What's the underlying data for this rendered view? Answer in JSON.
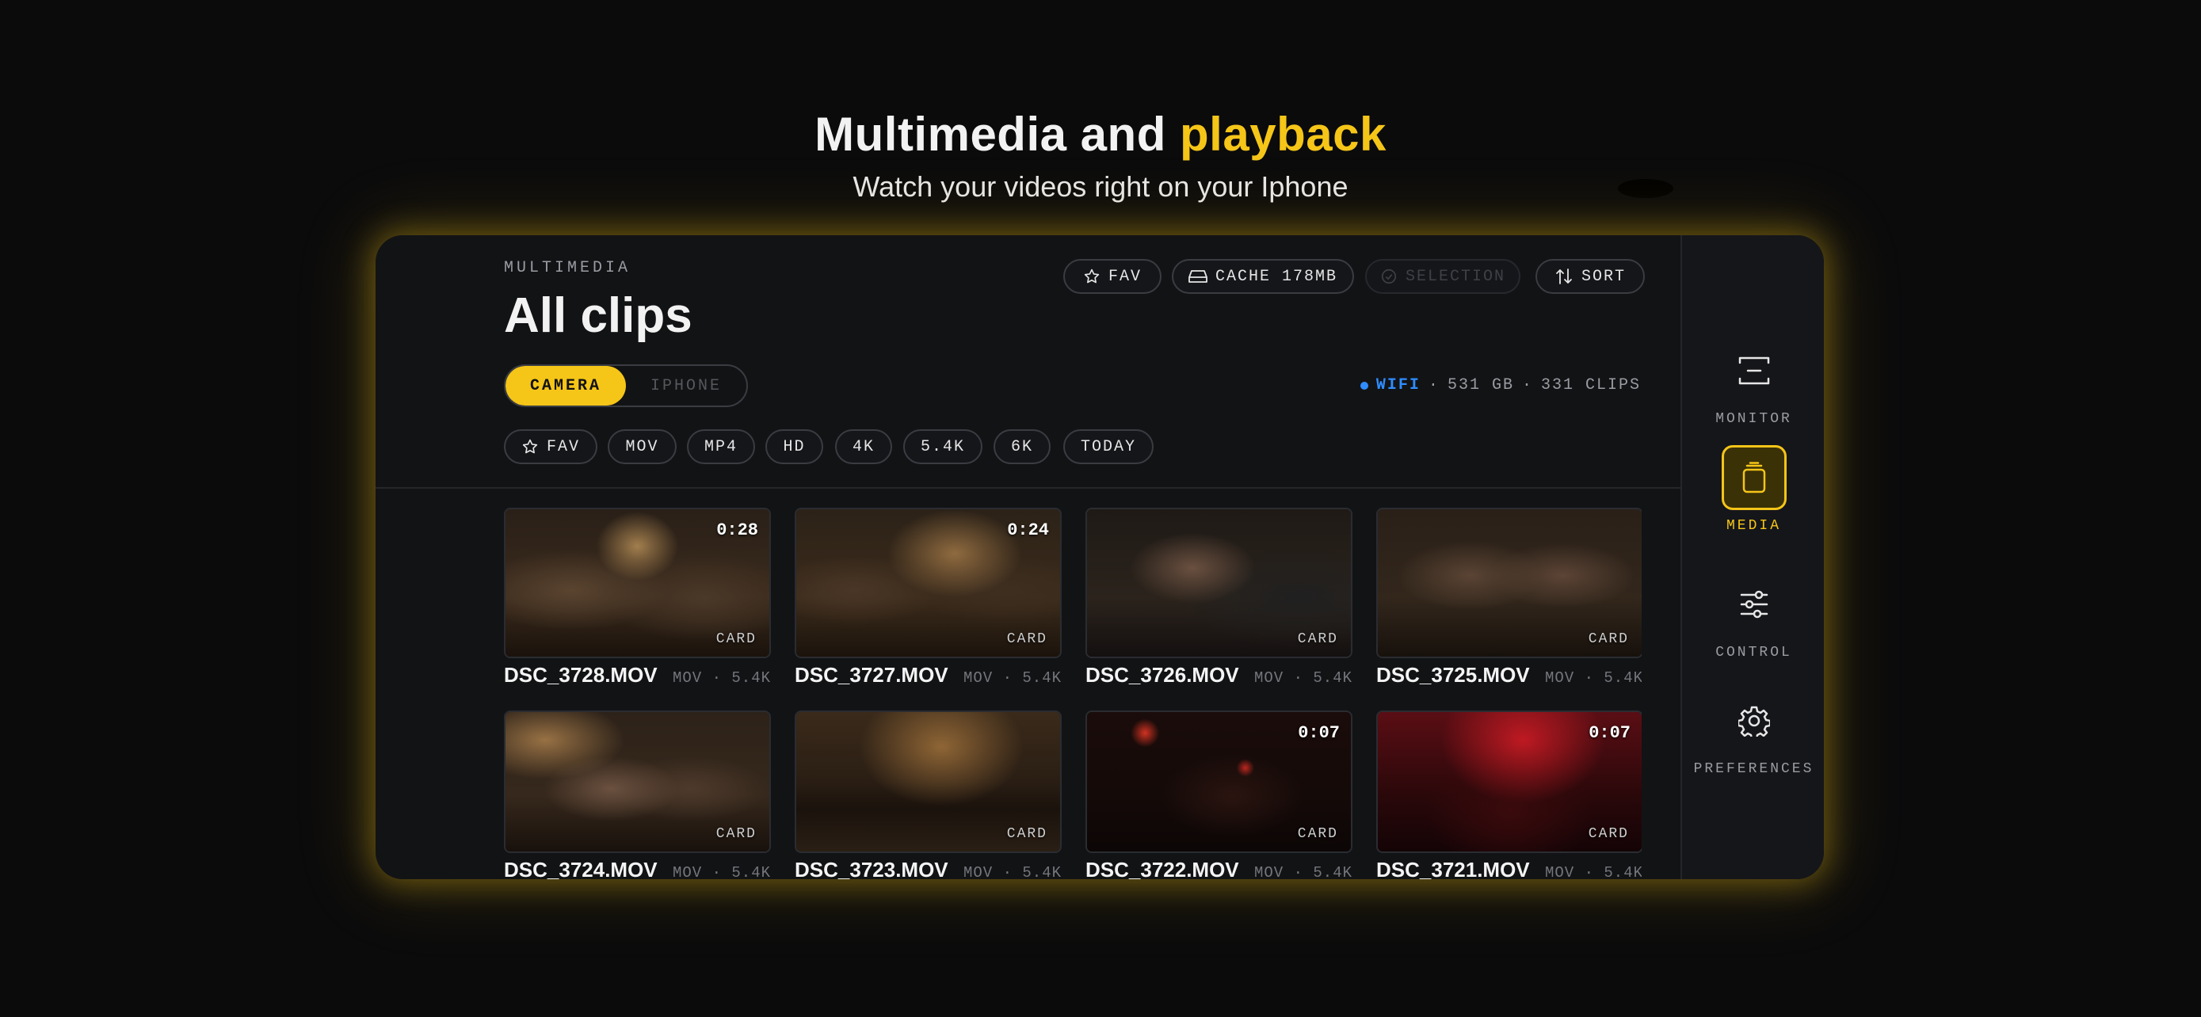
{
  "hero": {
    "title_main": "Multimedia and ",
    "title_accent": "playback",
    "subtitle": "Watch your videos right on your Iphone"
  },
  "header": {
    "section_label": "MULTIMEDIA",
    "title": "All clips",
    "actions": {
      "fav": "FAV",
      "cache": "CACHE 178MB",
      "selection": "SELECTION",
      "sort": "SORT"
    }
  },
  "source_toggle": {
    "options": [
      "CAMERA",
      "IPHONE"
    ],
    "selected": "CAMERA"
  },
  "status": {
    "connection": "WIFI",
    "storage": "531 GB",
    "count": "331 CLIPS",
    "sep": "·",
    "connection_color": "#2f8cff"
  },
  "filters": [
    "FAV",
    "MOV",
    "MP4",
    "HD",
    "4K",
    "5.4K",
    "6K",
    "TODAY"
  ],
  "clips": [
    {
      "name": "DSC_3728.MOV",
      "format": "MOV",
      "res": "5.4K",
      "source": "CARD",
      "duration": "0:28"
    },
    {
      "name": "DSC_3727.MOV",
      "format": "MOV",
      "res": "5.4K",
      "source": "CARD",
      "duration": "0:24"
    },
    {
      "name": "DSC_3726.MOV",
      "format": "MOV",
      "res": "5.4K",
      "source": "CARD",
      "duration": ""
    },
    {
      "name": "DSC_3725.MOV",
      "format": "MOV",
      "res": "5.4K",
      "source": "CARD",
      "duration": ""
    },
    {
      "name": "DSC_3724.MOV",
      "format": "MOV",
      "res": "5.4K",
      "source": "CARD",
      "duration": ""
    },
    {
      "name": "DSC_3723.MOV",
      "format": "MOV",
      "res": "5.4K",
      "source": "CARD",
      "duration": ""
    },
    {
      "name": "DSC_3722.MOV",
      "format": "MOV",
      "res": "5.4K",
      "source": "CARD",
      "duration": "0:07"
    },
    {
      "name": "DSC_3721.MOV",
      "format": "MOV",
      "res": "5.4K",
      "source": "CARD",
      "duration": "0:07"
    }
  ],
  "sidebar": {
    "items": [
      {
        "label": "MONITOR",
        "icon": "monitor-icon",
        "active": false
      },
      {
        "label": "MEDIA",
        "icon": "media-icon",
        "active": true
      },
      {
        "label": "CONTROL",
        "icon": "sliders-icon",
        "active": false
      },
      {
        "label": "PREFERENCES",
        "icon": "gear-icon",
        "active": false
      }
    ]
  },
  "colors": {
    "accent": "#f5c518",
    "background": "#0b0b0c",
    "panel": "#121315"
  }
}
